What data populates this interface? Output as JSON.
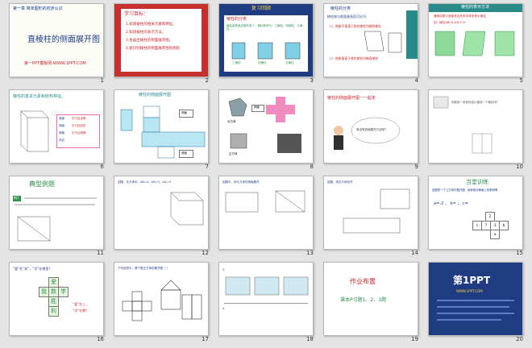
{
  "slides": [
    {
      "num": "1",
      "header": "第一章  简单图形的初步认识",
      "title": "直棱柱的侧面展开图",
      "footer": "第一PPT模板网-WWW.1PPT.COM"
    },
    {
      "num": "2",
      "heading": "学习目标：",
      "items": [
        "1.知道棱柱的相关元素和特征。",
        "2.知道棱柱的表示方法。",
        "3.会画出棱柱的侧面展开图。",
        "4.能识别棱柱的侧面展开图的图形"
      ]
    },
    {
      "num": "3",
      "tag": "复习回顾",
      "lead": "棱柱的分类",
      "text": "棱柱按底面边数的多少，棱柱称呼为：三棱柱、四棱柱、五棱柱……",
      "captions": [
        "三棱柱",
        "四棱柱",
        "五棱柱"
      ]
    },
    {
      "num": "4",
      "title": "棱柱的分类",
      "intro": "棱柱按与底面垂直否可分为:",
      "q1": "（1）侧棱不垂直于底的棱柱叫做斜棱柱",
      "q2": "（2）侧棱垂直于底的棱柱叫做直棱柱",
      "side": "斜棱柱和直棱柱"
    },
    {
      "num": "5",
      "heading": "棱柱的表示方法",
      "text": "通常用表示底面多边形的字母来表示棱柱",
      "example": "如：棱柱ABCD-A'B'C'D'"
    },
    {
      "num": "6",
      "heading": "棱柱的基本元素和结构特征。",
      "labels": [
        "底面",
        "平行且全等",
        "侧面",
        "平行四边形",
        "侧棱",
        "平行且相等",
        "顶点"
      ]
    },
    {
      "num": "7",
      "heading": "棱柱的侧面展开图",
      "labels": [
        "侧面",
        "底面"
      ]
    },
    {
      "num": "8",
      "labels": [
        "长方体",
        "侧面",
        "正方体"
      ]
    },
    {
      "num": "9",
      "heading": "棱柱的侧面展开图一一起走",
      "bubble": "有没有其他展开方法呢？"
    },
    {
      "num": "10",
      "text": "你能用一张矩形纸片做成一个棱柱吗？"
    },
    {
      "num": "11",
      "heading": "典型例题",
      "example": "例1"
    },
    {
      "num": "12",
      "text": "如图，长方体中，AB=4，AD=3，AA'=5"
    },
    {
      "num": "13",
      "text": "如图中，将长方体的侧面展开"
    },
    {
      "num": "14",
      "text": "如图，将长方体切开"
    },
    {
      "num": "15",
      "heading": "当堂训练",
      "q": "如图是一个立方体的展开图，使其相对两面上的数相等",
      "formula": "a=-2 ， b= ， c=",
      "nums": [
        "2",
        "c",
        "7",
        "-1",
        "b",
        "a"
      ]
    },
    {
      "num": "16",
      "q": "“爱”在“前”，“学”在哪里？",
      "chars": [
        "爱",
        "我",
        "数",
        "学",
        "胜",
        "利"
      ],
      "note1": "“爱”在上，",
      "note2": "“学”在哪？"
    },
    {
      "num": "17",
      "q": "下列选项中，哪个是正方体的展开图（ ）"
    },
    {
      "num": "18",
      "q3": "3.",
      "q4": "4."
    },
    {
      "num": "19",
      "title": "作业布置",
      "task": "课本P习题1、2、3题"
    },
    {
      "num": "20",
      "brand": "第1PPT",
      "sub": "WWW.1PPT.COM"
    }
  ],
  "colors": {
    "navy": "#1f3c83",
    "red": "#c8252b",
    "green": "#2f8f4f",
    "teal": "#2a8a8a",
    "pink": "#e96bb0"
  }
}
